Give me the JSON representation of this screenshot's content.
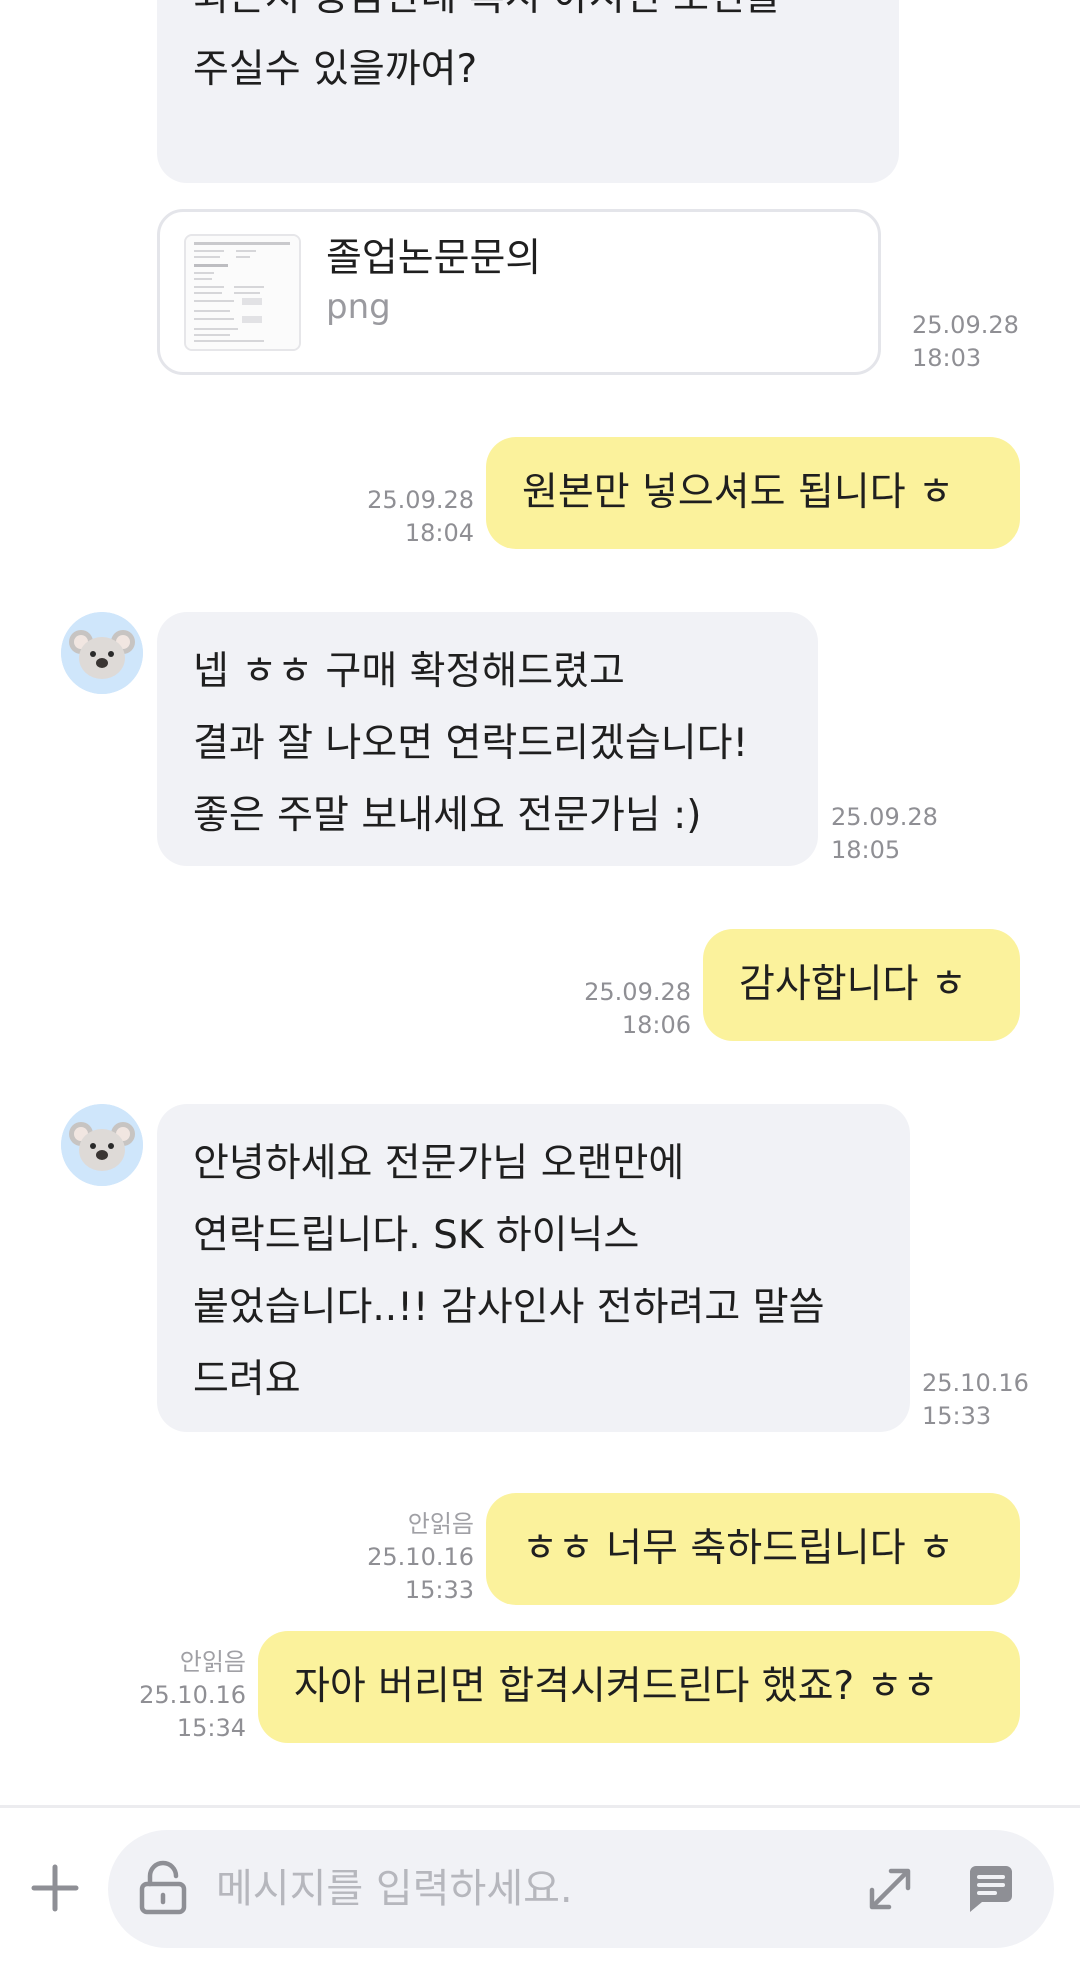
{
  "colors": {
    "incoming_bubble": "#f1f2f6",
    "outgoing_bubble": "#fbf29c",
    "timestamp": "#8f8f94",
    "input_bar": "#f1f2f6",
    "icon": "#8e8f95"
  },
  "messages": [
    {
      "id": "m0",
      "direction": "incoming",
      "lines": [
        "",
        "되는지 궁금한데 혹시 아시면 조언을",
        "주실수 있을까여?"
      ]
    },
    {
      "id": "m1",
      "direction": "incoming",
      "type": "file",
      "file_name": "졸업논문문의",
      "file_ext": "png",
      "date": "25.09.28",
      "time": "18:03"
    },
    {
      "id": "m2",
      "direction": "outgoing",
      "text": "원본만 넣으셔도 됩니다 ㅎ",
      "date": "25.09.28",
      "time": "18:04"
    },
    {
      "id": "m3",
      "direction": "incoming",
      "lines": [
        "넵 ㅎㅎ 구매 확정해드렸고",
        "결과 잘 나오면 연락드리겠습니다!",
        "좋은 주말 보내세요 전문가님 :)"
      ],
      "date": "25.09.28",
      "time": "18:05"
    },
    {
      "id": "m4",
      "direction": "outgoing",
      "text": "감사합니다 ㅎ",
      "date": "25.09.28",
      "time": "18:06"
    },
    {
      "id": "m5",
      "direction": "incoming",
      "lines": [
        "안녕하세요 전문가님 오랜만에",
        "연락드립니다. SK 하이닉스",
        "붙었습니다..!! 감사인사 전하려고 말씀",
        "드려요"
      ],
      "date": "25.10.16",
      "time": "15:33"
    },
    {
      "id": "m6",
      "direction": "outgoing",
      "text": "ㅎㅎ 너무 축하드립니다 ㅎ",
      "status": "안읽음",
      "date": "25.10.16",
      "time": "15:33"
    },
    {
      "id": "m7",
      "direction": "outgoing",
      "text": "자아 버리면 합격시켜드린다 했죠? ㅎㅎ",
      "status": "안읽음",
      "date": "25.10.16",
      "time": "15:34"
    }
  ],
  "composer": {
    "placeholder": "메시지를 입력하세요.",
    "icons": {
      "add": "plus-icon",
      "lock": "unlock-icon",
      "expand": "expand-icon",
      "send": "chat-send-icon"
    }
  },
  "avatar": {
    "icon": "koala-icon"
  }
}
